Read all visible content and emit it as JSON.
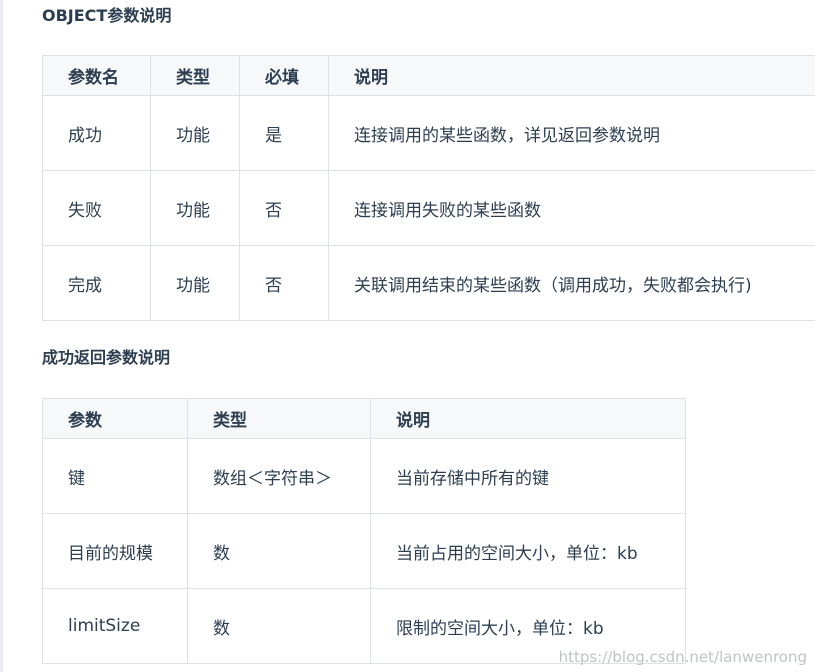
{
  "section1": {
    "title": "OBJECT参数说明",
    "headers": [
      "参数名",
      "类型",
      "必填",
      "说明"
    ],
    "rows": [
      [
        "成功",
        "功能",
        "是",
        "连接调用的某些函数，详见返回参数说明"
      ],
      [
        "失败",
        "功能",
        "否",
        "连接调用失败的某些函数"
      ],
      [
        "完成",
        "功能",
        "否",
        "关联调用结束的某些函数（调用成功，失败都会执行)"
      ]
    ]
  },
  "section2": {
    "title": "成功返回参数说明",
    "headers": [
      "参数",
      "类型",
      "说明"
    ],
    "rows": [
      [
        "键",
        "数组＜字符串＞",
        "当前存储中所有的键"
      ],
      [
        "目前的规模",
        "数",
        "当前占用的空间大小，单位：kb"
      ],
      [
        "limitSize",
        "数",
        "限制的空间大小，单位：kb"
      ]
    ]
  },
  "watermark": "https://blog.csdn.net/lanwenrong"
}
